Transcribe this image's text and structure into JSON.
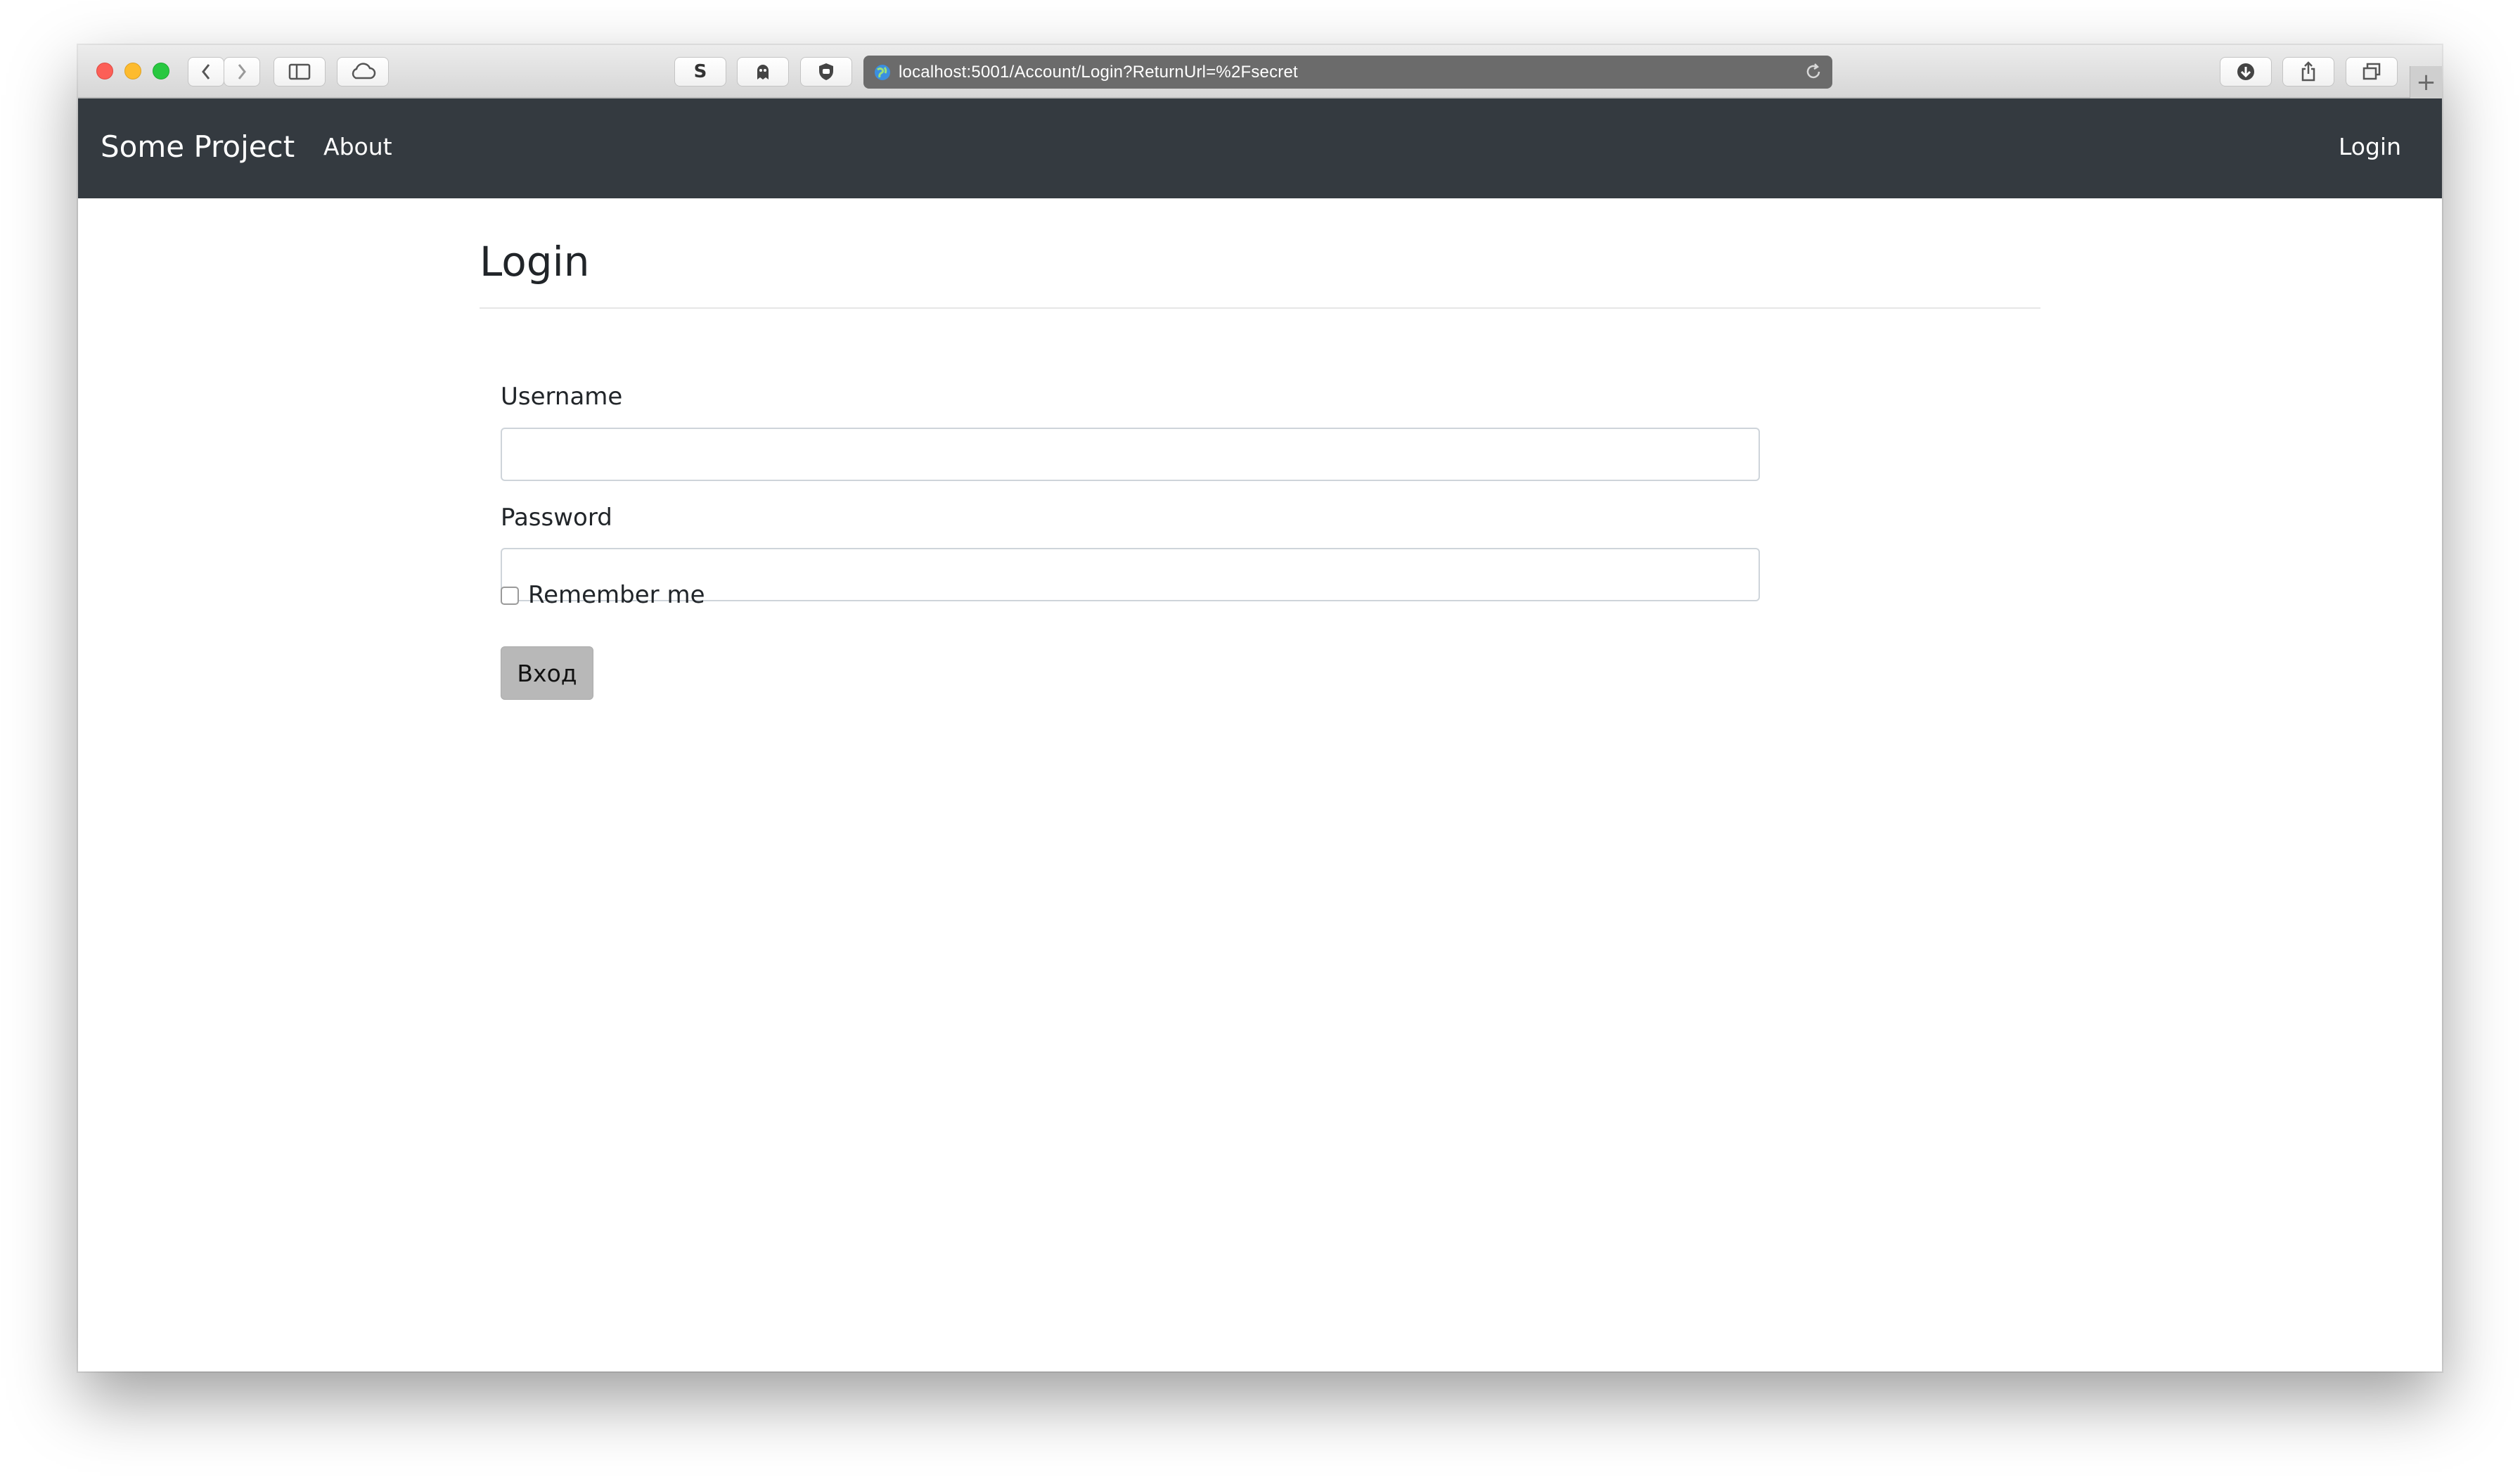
{
  "browser": {
    "url": "localhost:5001/Account/Login?ReturnUrl=%2Fsecret",
    "extension_s_label": "S"
  },
  "navbar": {
    "brand": "Some Project",
    "about": "About",
    "login": "Login"
  },
  "page": {
    "title": "Login",
    "username_label": "Username",
    "username_value": "",
    "password_label": "Password",
    "password_value": "",
    "remember_label": "Remember me",
    "remember_checked": false,
    "submit_label": "Вход"
  },
  "colors": {
    "navbar_bg": "#343a40",
    "button_bg": "#b8b8b8",
    "urlbar_bg": "#6b6b6b"
  },
  "icons": [
    "back-icon",
    "forward-icon",
    "sidebar-icon",
    "cloud-icon",
    "ghost-icon",
    "shield-icon",
    "globe-icon",
    "reload-icon",
    "download-icon",
    "share-icon",
    "tabs-icon",
    "plus-icon"
  ]
}
